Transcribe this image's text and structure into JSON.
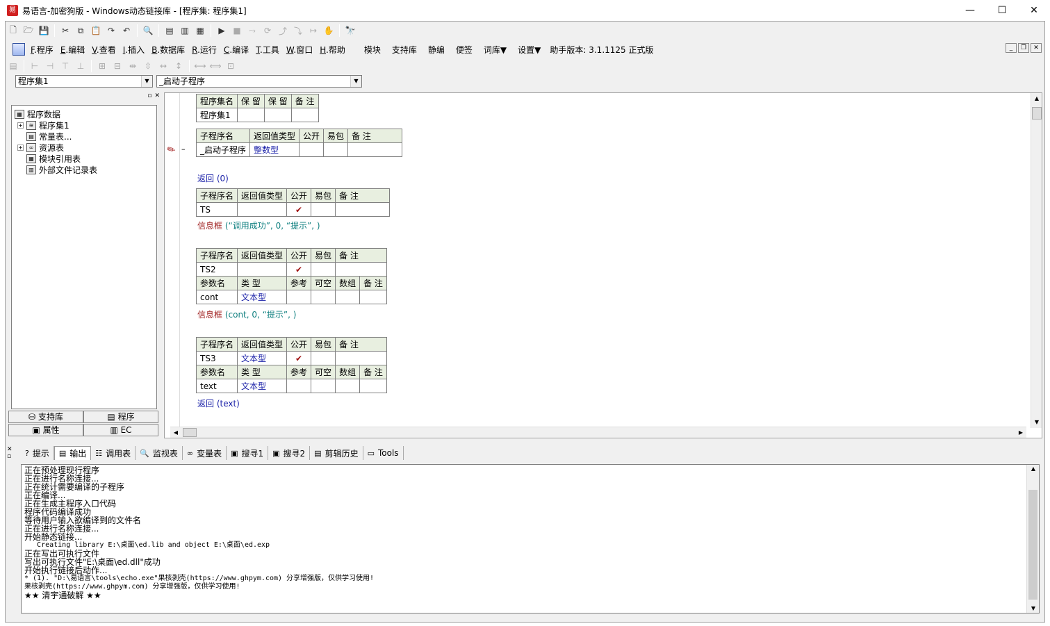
{
  "window": {
    "title": "易语言-加密狗版 - Windows动态链接库 - [程序集: 程序集1]",
    "buttons": {
      "minimize": "—",
      "maximize": "☐",
      "close": "✕"
    }
  },
  "toolbar1": {
    "icons": [
      "new-file-icon",
      "open-folder-icon",
      "save-icon",
      "cut-icon",
      "copy-icon",
      "paste-icon",
      "redo-icon",
      "undo-icon",
      "find-icon",
      "layout-1-icon",
      "layout-2-icon",
      "layout-3-icon",
      "run-icon",
      "stop-icon",
      "step-icon",
      "step-into-icon",
      "step-out-icon",
      "step-over-icon",
      "run-to-cursor-icon",
      "hand-icon",
      "binoculars-icon"
    ],
    "glyphs": [
      "🗋",
      "🗁",
      "💾",
      "✂",
      "⧉",
      "📋",
      "↷",
      "↶",
      "🔍",
      "▤",
      "▥",
      "▦",
      "▶",
      "■",
      "⤳",
      "⟳",
      "⤴",
      "⤵",
      "↦",
      "✋",
      "🔭"
    ]
  },
  "menu": {
    "items": [
      {
        "key": "F",
        "label": ".程序"
      },
      {
        "key": "E",
        "label": ".编辑"
      },
      {
        "key": "V",
        "label": ".查看"
      },
      {
        "key": "I",
        "label": ".插入"
      },
      {
        "key": "B",
        "label": ".数据库"
      },
      {
        "key": "R",
        "label": ".运行"
      },
      {
        "key": "C",
        "label": ".编译"
      },
      {
        "key": "T",
        "label": ".工具"
      },
      {
        "key": "W",
        "label": ".窗口"
      },
      {
        "key": "H",
        "label": ".帮助"
      }
    ],
    "extra": [
      "模块",
      "支持库",
      "静编",
      "便签",
      "词库▼",
      "设置▼"
    ],
    "version_label": "助手版本: 3.1.1125 正式版"
  },
  "selectors": {
    "assembly": "程序集1",
    "subroutine": "_启动子程序"
  },
  "tree": {
    "root": "程序数据",
    "items": [
      {
        "label": "程序集1",
        "expandable": true
      },
      {
        "label": "常量表...",
        "expandable": false
      },
      {
        "label": "资源表",
        "expandable": true
      },
      {
        "label": "模块引用表",
        "expandable": false
      },
      {
        "label": "外部文件记录表",
        "expandable": false
      }
    ]
  },
  "left_tabs": {
    "row1": [
      "支持库",
      "程序"
    ],
    "row2": [
      "属性",
      "EC"
    ]
  },
  "code": {
    "assembly_table": {
      "headers": [
        "程序集名",
        "保 留",
        "保 留",
        "备 注"
      ],
      "row": [
        "程序集1",
        "",
        "",
        ""
      ]
    },
    "sub_headers": [
      "子程序名",
      "返回值类型",
      "公开",
      "易包",
      "备 注"
    ],
    "param_headers": [
      "参数名",
      "类 型",
      "参考",
      "可空",
      "数组",
      "备 注"
    ],
    "sub1": {
      "name": "_启动子程序",
      "ret": "整数型",
      "public": ""
    },
    "line1": "返回 (0)",
    "sub2": {
      "name": "TS",
      "ret": "",
      "public": "✔"
    },
    "line2_fn": "信息框",
    "line2_args": " (“调用成功”, 0, “提示”, )",
    "sub3": {
      "name": "TS2",
      "ret": "",
      "public": "✔"
    },
    "sub3_param": {
      "name": "cont",
      "type": "文本型"
    },
    "line3_fn": "信息框",
    "line3_args": " (cont, 0, “提示”, )",
    "sub4": {
      "name": "TS3",
      "ret": "文本型",
      "public": "✔"
    },
    "sub4_param": {
      "name": "text",
      "type": "文本型"
    },
    "line4": "返回 (text)"
  },
  "output_tabs": [
    {
      "label": "提示",
      "icon": "?"
    },
    {
      "label": "输出",
      "icon": "▤"
    },
    {
      "label": "调用表",
      "icon": "☷"
    },
    {
      "label": "监视表",
      "icon": "🔍"
    },
    {
      "label": "变量表",
      "icon": "∞"
    },
    {
      "label": "搜寻1",
      "icon": "▣"
    },
    {
      "label": "搜寻2",
      "icon": "▣"
    },
    {
      "label": "剪辑历史",
      "icon": "▤"
    },
    {
      "label": "Tools",
      "icon": "▭"
    }
  ],
  "output_lines": [
    "正在预处理现行程序",
    "正在进行名称连接...",
    "正在统计需要编译的子程序",
    "正在编译...",
    "正在生成主程序入口代码",
    "程序代码编译成功",
    "等待用户输入欲编译到的文件名",
    "正在进行名称连接...",
    "开始静态链接...",
    "   Creating library E:\\桌面\\ed.lib and object E:\\桌面\\ed.exp",
    "正在写出可执行文件",
    "写出可执行文件\"E:\\桌面\\ed.dll\"成功",
    "开始执行链接后动作...",
    "* (1). \"D:\\易语言\\tools\\echo.exe\"果核剥壳(https://www.ghpym.com) 分享增强版，仅供学习使用!",
    "果核剥壳(https://www.ghpym.com) 分享增强版，仅供学习使用!",
    "★★ 清宇通破解 ★★"
  ]
}
